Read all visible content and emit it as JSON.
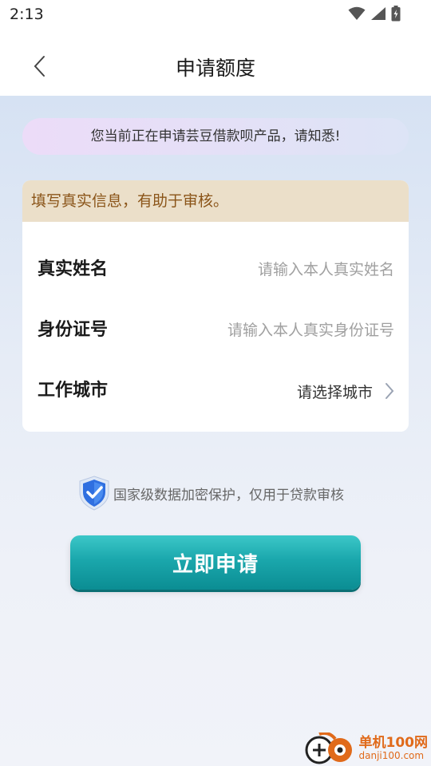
{
  "status_bar": {
    "time": "2:13"
  },
  "header": {
    "title": "申请额度"
  },
  "notice": {
    "text": "您当前正在申请芸豆借款呗产品，请知悉!"
  },
  "form": {
    "hint": "填写真实信息，有助于审核。",
    "rows": [
      {
        "label": "真实姓名",
        "placeholder": "请输入本人真实姓名",
        "value": ""
      },
      {
        "label": "身份证号",
        "placeholder": "请输入本人真实身份证号",
        "value": ""
      },
      {
        "label": "工作城市",
        "select_text": "请选择城市"
      }
    ]
  },
  "security": {
    "text": "国家级数据加密保护，仅用于贷款审核"
  },
  "actions": {
    "apply_label": "立即申请"
  },
  "watermark": {
    "name": "单机100网",
    "url": "danji100.com"
  },
  "colors": {
    "accent": "#18a4aa",
    "hint_bg": "#ebdfc9",
    "hint_text": "#8a5418",
    "notice_start": "#ecdcf8",
    "notice_end": "#dde4f6"
  },
  "icons": {
    "back": "chevron-left-icon",
    "wifi": "wifi-icon",
    "signal": "signal-icon",
    "battery": "battery-icon",
    "select": "chevron-right-icon",
    "shield": "shield-icon"
  }
}
